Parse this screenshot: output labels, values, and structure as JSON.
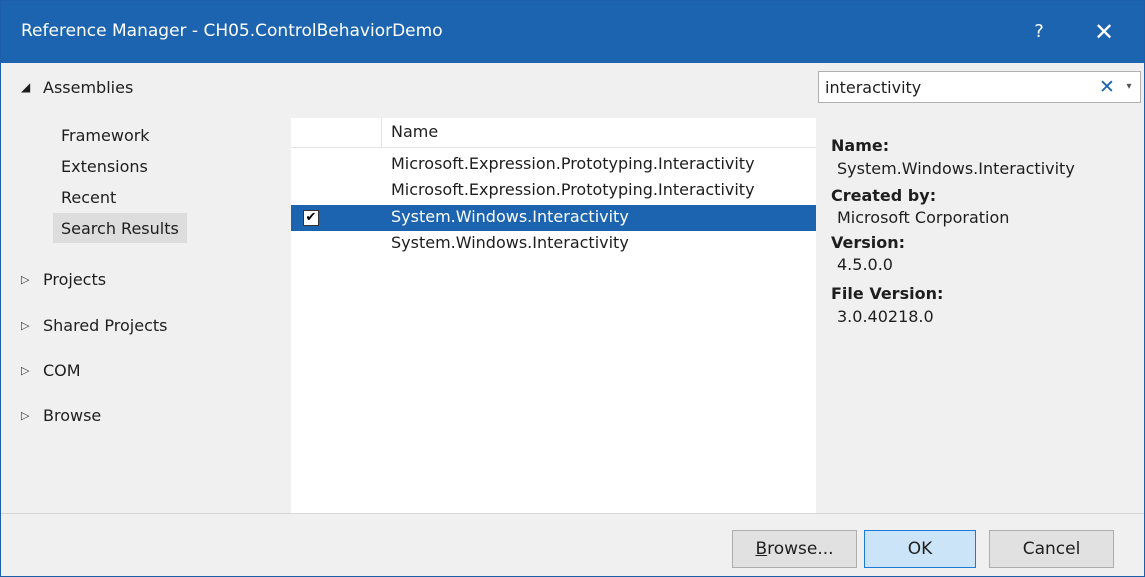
{
  "window": {
    "title": "Reference Manager - CH05.ControlBehaviorDemo",
    "help_label": "?",
    "close_label": "✕"
  },
  "nav": {
    "assemblies": {
      "label": "Assemblies",
      "expanded_icon": "◢"
    },
    "assemblies_items": [
      {
        "label": "Framework",
        "selected": false
      },
      {
        "label": "Extensions",
        "selected": false
      },
      {
        "label": "Recent",
        "selected": false
      },
      {
        "label": "Search Results",
        "selected": true
      }
    ],
    "collapsed_icon": "▷",
    "groups": [
      {
        "label": "Projects"
      },
      {
        "label": "Shared Projects"
      },
      {
        "label": "COM"
      },
      {
        "label": "Browse"
      }
    ]
  },
  "search": {
    "value": "interactivity",
    "clear_label": "✕",
    "dropdown_label": "▾"
  },
  "list": {
    "column_name": "Name",
    "rows": [
      {
        "name": "Microsoft.Expression.Prototyping.Interactivity",
        "checked": false,
        "selected": false
      },
      {
        "name": "Microsoft.Expression.Prototyping.Interactivity",
        "checked": false,
        "selected": false
      },
      {
        "name": "System.Windows.Interactivity",
        "checked": true,
        "selected": true
      },
      {
        "name": "System.Windows.Interactivity",
        "checked": false,
        "selected": false
      }
    ],
    "check_mark": "✔"
  },
  "details": {
    "name_label": "Name:",
    "name_value": "System.Windows.Interactivity",
    "created_label": "Created by:",
    "created_value": "Microsoft Corporation",
    "version_label": "Version:",
    "version_value": "4.5.0.0",
    "file_version_label": "File Version:",
    "file_version_value": "3.0.40218.0"
  },
  "buttons": {
    "browse_first": "B",
    "browse_rest": "rowse...",
    "ok": "OK",
    "cancel": "Cancel"
  },
  "colors": {
    "accent": "#1c64b0",
    "selected_nav": "#dddddd",
    "ok_button": "#cce4f7"
  }
}
